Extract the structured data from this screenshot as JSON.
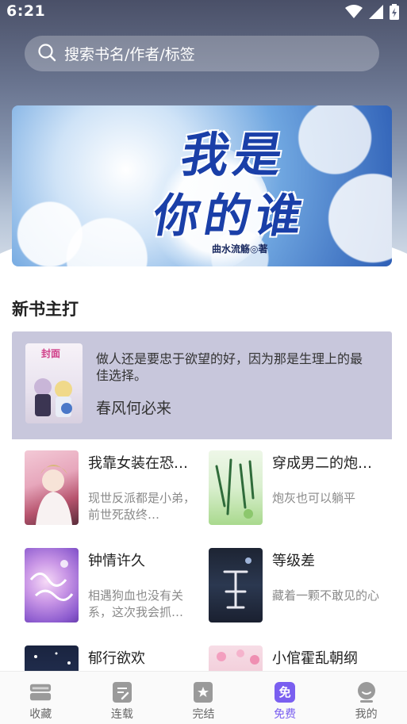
{
  "status_bar": {
    "time": "6:21"
  },
  "search": {
    "placeholder": "搜索书名/作者/标签"
  },
  "banner": {
    "title_line1": "我是",
    "title_line2": "你的谁",
    "author": "曲水流觞◎著"
  },
  "new_books": {
    "section_title": "新书主打",
    "featured": {
      "description": "做人还是要忠于欲望的好，因为那是生理上的最佳选择。",
      "author": "春风何必来",
      "cover_text": "封面"
    },
    "books": [
      {
        "title": "我靠女装在恐…",
        "description": "现世反派都是小弟，前世死敌终…"
      },
      {
        "title": "穿成男二的炮…",
        "description": "炮灰也可以躺平"
      },
      {
        "title": "钟情许久",
        "description": "相遇狗血也没有关系，这次我会抓…"
      },
      {
        "title": "等级差",
        "description": "藏着一颗不敢见的心"
      },
      {
        "title": "郁行欲欢",
        "description": ""
      },
      {
        "title": "小倌霍乱朝纲",
        "description": ""
      }
    ]
  },
  "tabs": [
    {
      "label": "收藏",
      "icon": "bookshelf-icon"
    },
    {
      "label": "连载",
      "icon": "serial-icon"
    },
    {
      "label": "完结",
      "icon": "completed-icon"
    },
    {
      "label": "免费",
      "icon": "free-icon",
      "badge": "免"
    },
    {
      "label": "我的",
      "icon": "profile-icon"
    }
  ],
  "colors": {
    "accent": "#7a5ff0",
    "feature_bg": "#c8c7dc"
  }
}
